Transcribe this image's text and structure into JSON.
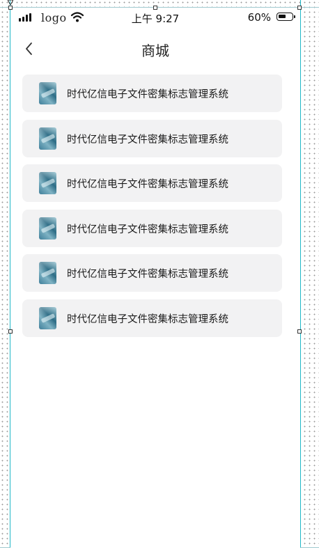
{
  "status_bar": {
    "carrier": "logo",
    "time": "上午 9:27",
    "battery_percent": "60%",
    "battery_level": 0.6,
    "icons": [
      "signal-icon",
      "wifi-icon",
      "battery-icon"
    ]
  },
  "nav": {
    "title": "商城",
    "back_icon": "chevron-left-icon"
  },
  "items": [
    {
      "title": "时代亿信电子文件密集标志管理系统",
      "icon": "app-thumbnail"
    },
    {
      "title": "时代亿信电子文件密集标志管理系统",
      "icon": "app-thumbnail"
    },
    {
      "title": "时代亿信电子文件密集标志管理系统",
      "icon": "app-thumbnail"
    },
    {
      "title": "时代亿信电子文件密集标志管理系统",
      "icon": "app-thumbnail"
    },
    {
      "title": "时代亿信电子文件密集标志管理系统",
      "icon": "app-thumbnail"
    },
    {
      "title": "时代亿信电子文件密集标志管理系统",
      "icon": "app-thumbnail"
    }
  ],
  "colors": {
    "guide": "#1fb7c7",
    "item_background": "#f2f2f3",
    "text": "#1a1a1a"
  }
}
